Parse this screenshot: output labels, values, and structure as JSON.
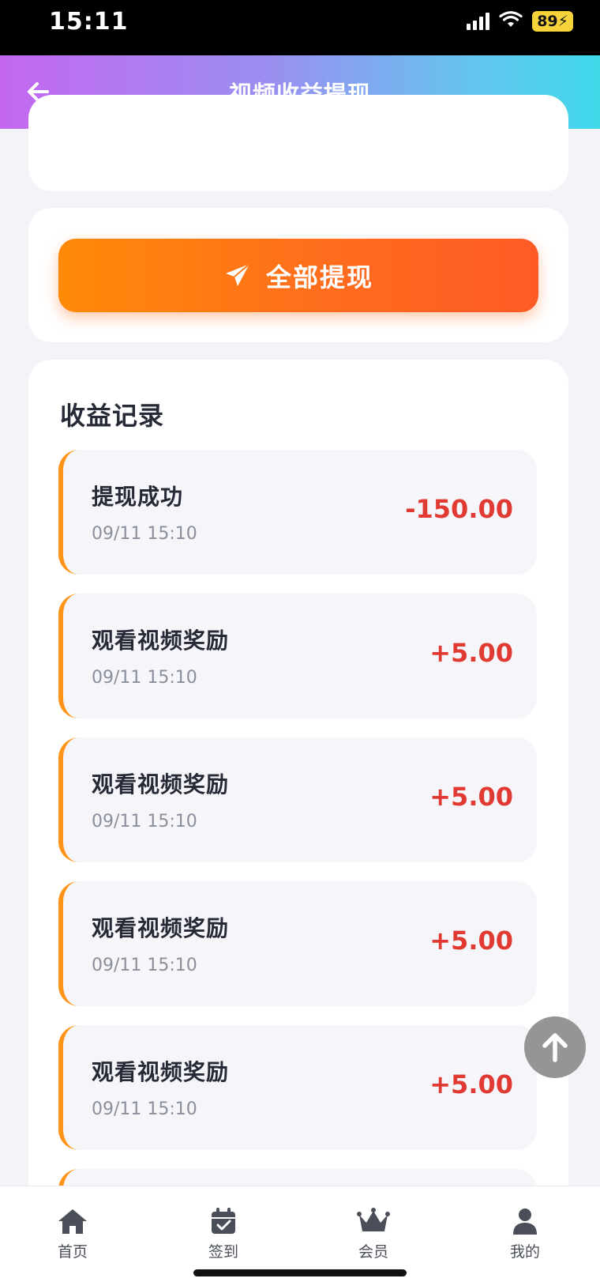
{
  "status_bar": {
    "time": "15:11",
    "battery": "89"
  },
  "header": {
    "title": "视频收益提现"
  },
  "withdraw": {
    "button_label": "全部提现"
  },
  "records": {
    "title": "收益记录",
    "items": [
      {
        "title": "提现成功",
        "time": "09/11 15:10",
        "amount": "-150.00"
      },
      {
        "title": "观看视频奖励",
        "time": "09/11 15:10",
        "amount": "+5.00"
      },
      {
        "title": "观看视频奖励",
        "time": "09/11 15:10",
        "amount": "+5.00"
      },
      {
        "title": "观看视频奖励",
        "time": "09/11 15:10",
        "amount": "+5.00"
      },
      {
        "title": "观看视频奖励",
        "time": "09/11 15:10",
        "amount": "+5.00"
      }
    ]
  },
  "nav": {
    "items": [
      {
        "label": "首页",
        "icon": "home-icon"
      },
      {
        "label": "签到",
        "icon": "calendar-check-icon"
      },
      {
        "label": "会员",
        "icon": "crown-icon"
      },
      {
        "label": "我的",
        "icon": "user-icon"
      }
    ]
  },
  "colors": {
    "accent_orange": "#ff7a12",
    "amount_red": "#e03a32",
    "header_gradient_start": "#c467f0",
    "header_gradient_end": "#3fd8e9"
  }
}
